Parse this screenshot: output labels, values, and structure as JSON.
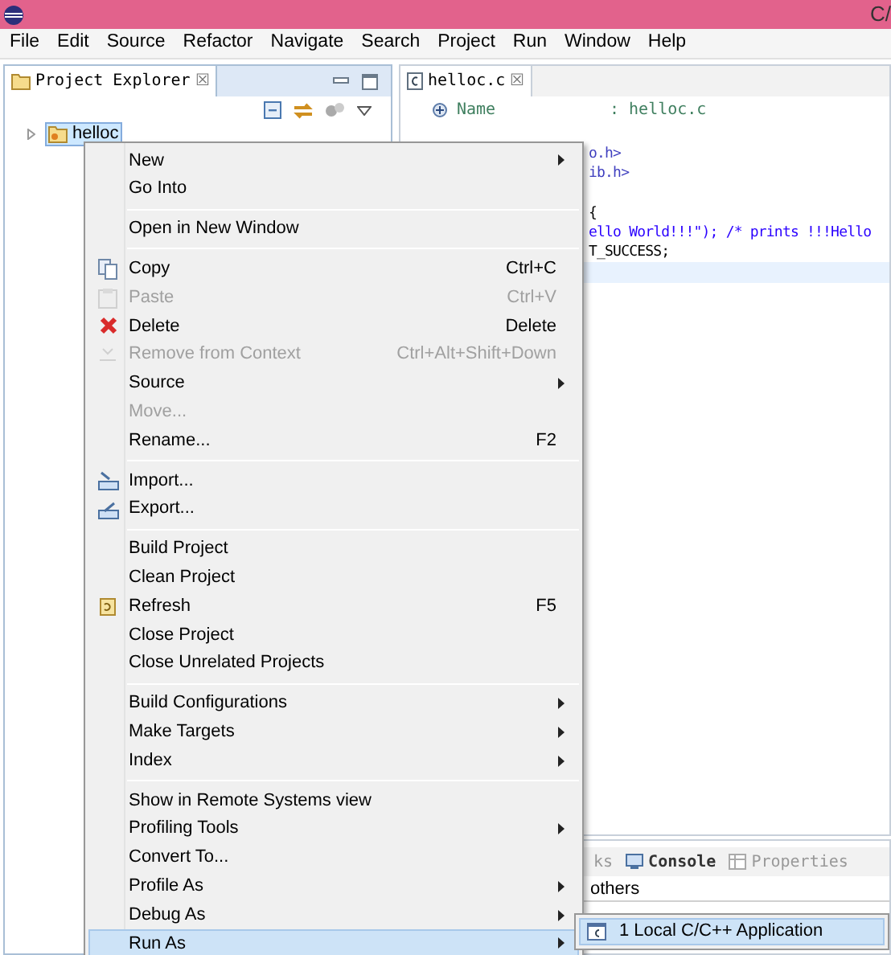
{
  "window": {
    "title": "C/"
  },
  "menu_bar": [
    "File",
    "Edit",
    "Source",
    "Refactor",
    "Navigate",
    "Search",
    "Project",
    "Run",
    "Window",
    "Help"
  ],
  "project_explorer": {
    "title": "Project Explorer",
    "close": "☒",
    "tree": [
      {
        "label": "helloc",
        "selected": true,
        "expanded": false
      }
    ]
  },
  "editor": {
    "tab": {
      "label": "helloc.c",
      "close": "☒"
    },
    "header": {
      "key": "Name",
      "value": ": helloc.c"
    },
    "code_lines": [
      {
        "text": "o.h>",
        "kind": "include"
      },
      {
        "text": "ib.h>",
        "kind": "include"
      },
      {
        "kind": "blank"
      },
      {
        "text": "{",
        "kind": "plain"
      },
      {
        "text": "ello World!!!\"); /* prints !!!Hello",
        "kind": "string"
      },
      {
        "text": "T_SUCCESS;",
        "kind": "plain"
      },
      {
        "kind": "current"
      }
    ]
  },
  "bottom_panel": {
    "tabs": [
      {
        "label": "ks",
        "kind": "cut"
      },
      {
        "label": "Console",
        "kind": "console"
      },
      {
        "label": "Properties",
        "kind": "properties"
      }
    ],
    "text": "others"
  },
  "context_menu": {
    "groups": [
      [
        {
          "label": "New",
          "submenu": true,
          "disabled": false,
          "selected": false
        },
        {
          "label": "Go Into",
          "disabled": false,
          "selected": false
        }
      ],
      [
        {
          "label": "Open in New Window",
          "disabled": false,
          "selected": false
        }
      ],
      [
        {
          "label": "Copy",
          "shortcut": "Ctrl+C",
          "kind": "copy",
          "disabled": false,
          "selected": false
        },
        {
          "label": "Paste",
          "shortcut": "Ctrl+V",
          "kind": "paste",
          "disabled": true,
          "selected": false
        },
        {
          "label": "Delete",
          "shortcut": "Delete",
          "kind": "delete",
          "disabled": false,
          "selected": false
        },
        {
          "label": "Remove from Context",
          "shortcut": "Ctrl+Alt+Shift+Down",
          "kind": "remove",
          "disabled": true,
          "selected": false
        },
        {
          "label": "Source",
          "submenu": true,
          "disabled": false,
          "selected": false
        },
        {
          "label": "Move...",
          "disabled": true,
          "selected": false
        },
        {
          "label": "Rename...",
          "shortcut": "F2",
          "disabled": false,
          "selected": false
        }
      ],
      [
        {
          "label": "Import...",
          "kind": "import",
          "disabled": false,
          "selected": false
        },
        {
          "label": "Export...",
          "kind": "export",
          "disabled": false,
          "selected": false
        }
      ],
      [
        {
          "label": "Build Project",
          "disabled": false,
          "selected": false
        },
        {
          "label": "Clean Project",
          "disabled": false,
          "selected": false
        },
        {
          "label": "Refresh",
          "shortcut": "F5",
          "kind": "refresh",
          "disabled": false,
          "selected": false
        },
        {
          "label": "Close Project",
          "disabled": false,
          "selected": false
        },
        {
          "label": "Close Unrelated Projects",
          "disabled": false,
          "selected": false
        }
      ],
      [
        {
          "label": "Build Configurations",
          "submenu": true,
          "disabled": false,
          "selected": false
        },
        {
          "label": "Make Targets",
          "submenu": true,
          "disabled": false,
          "selected": false
        },
        {
          "label": "Index",
          "submenu": true,
          "disabled": false,
          "selected": false
        }
      ],
      [
        {
          "label": "Show in Remote Systems view",
          "disabled": false,
          "selected": false
        },
        {
          "label": "Profiling Tools",
          "submenu": true,
          "disabled": false,
          "selected": false
        },
        {
          "label": "Convert To...",
          "disabled": false,
          "selected": false
        },
        {
          "label": "Profile As",
          "submenu": true,
          "disabled": false,
          "selected": false
        },
        {
          "label": "Debug As",
          "submenu": true,
          "disabled": false,
          "selected": false
        },
        {
          "label": "Run As",
          "submenu": true,
          "disabled": false,
          "selected": true
        }
      ]
    ]
  },
  "submenu": {
    "items": [
      {
        "label": "1 Local C/C++ Application",
        "selected": true
      }
    ]
  }
}
